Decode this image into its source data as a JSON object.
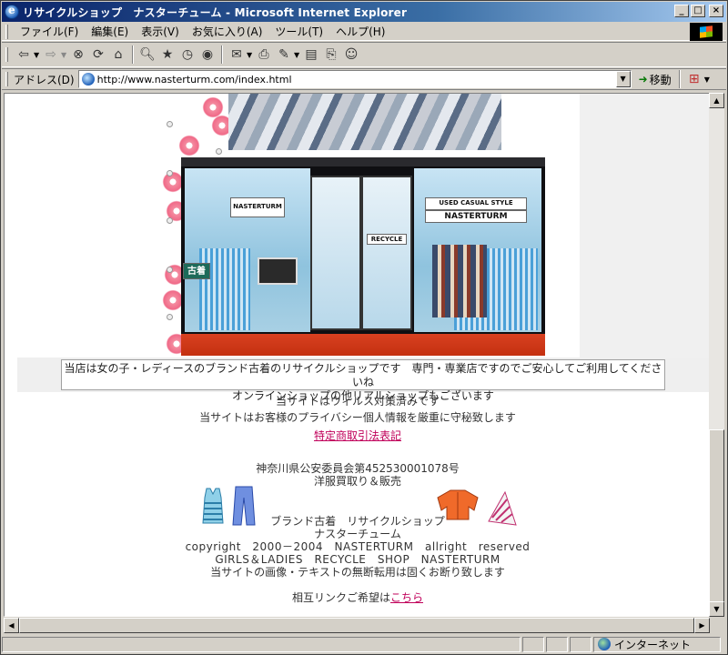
{
  "window": {
    "title": "リサイクルショップ　ナスターチューム - Microsoft Internet Explorer",
    "btn_min": "_",
    "btn_max": "□",
    "btn_close": "×"
  },
  "menu": [
    "ファイル(F)",
    "編集(E)",
    "表示(V)",
    "お気に入り(A)",
    "ツール(T)",
    "ヘルプ(H)"
  ],
  "toolbar": {
    "icons": [
      "back-icon",
      "forward-icon",
      "stop-icon",
      "refresh-icon",
      "home-icon",
      "search-icon",
      "favorites-icon",
      "history-icon",
      "media-icon",
      "mail-icon",
      "print-icon",
      "edit-icon",
      "discuss-icon",
      "messenger-icon"
    ]
  },
  "address": {
    "label": "アドレス(D)",
    "url": "http://www.nasterturm.com/index.html",
    "go_label": "移動"
  },
  "page": {
    "signs": {
      "used_casual": "USED CASUAL STYLE",
      "brand_big": "NASTERTURM",
      "recycle": "RECYCLE",
      "brand_small": "NASTERTURM",
      "furugi": "古着"
    },
    "notice_line1": "当店は女の子・レディースのブランド古着のリサイクルショップです　専門・専業店ですのでご安心してご利用してくださいね",
    "notice_line2": "オンラインショップの他リアルショップもございます",
    "virus": "当サイトはウィルス対策済みです",
    "privacy": "当サイトはお客様のプライバシー個人情報を厳重に守秘致します",
    "tokutei_link": "特定商取引法表記",
    "license": "神奈川県公安委員会第452530001078号",
    "business": "洋服買取り＆販売",
    "shop_line1": "ブランド古着　リサイクルショップ",
    "shop_line2": "ナスターチューム",
    "copyright": "copyright　2000－2004　NASTERTURM　allright　reserved",
    "girls": "GIRLS＆LADIES　RECYCLE　SHOP　NASTERTURM",
    "no_reuse": "当サイトの画像・テキストの無断転用は固くお断り致します",
    "mutual_prefix": "相互リンクご希望は",
    "mutual_link": "こちら"
  },
  "status": {
    "zone": "インターネット"
  },
  "colors": {
    "title_start": "#0a246a",
    "link": "#c0005a",
    "floor_red": "#d84020"
  }
}
